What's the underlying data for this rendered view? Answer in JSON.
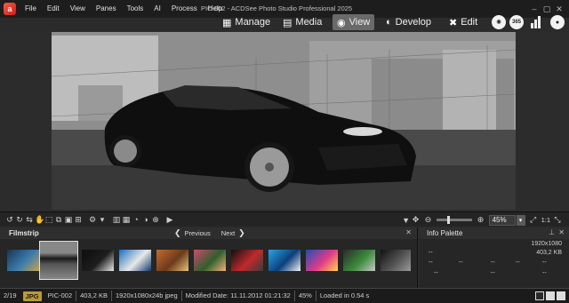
{
  "app": {
    "logo_letter": "a",
    "window_title": "PIC-002 - ACDSee Photo Studio Professional 2025"
  },
  "menu": [
    {
      "id": "file",
      "label": "File"
    },
    {
      "id": "edit",
      "label": "Edit"
    },
    {
      "id": "view",
      "label": "View"
    },
    {
      "id": "panes",
      "label": "Panes"
    },
    {
      "id": "tools",
      "label": "Tools"
    },
    {
      "id": "ai",
      "label": "AI"
    },
    {
      "id": "process",
      "label": "Process"
    },
    {
      "id": "help",
      "label": "Help"
    }
  ],
  "modes": {
    "manage": "Manage",
    "media": "Media",
    "view": "View",
    "develop": "Develop",
    "edit": "Edit",
    "active": "View",
    "badge_365": "365"
  },
  "viewer_toolbar": {
    "zoom_value": "45%",
    "zoom_slider_fraction": 0.3,
    "ratio_label": "1:1"
  },
  "filmstrip": {
    "title": "Filmstrip",
    "previous": "Previous",
    "next": "Next",
    "thumbnails": [
      {
        "name": "thumb-1",
        "palette": [
          "#1a3550",
          "#3b7cae",
          "#c9a34b"
        ]
      },
      {
        "name": "thumb-2-selected",
        "palette": [
          "#888",
          "#1a1a1a",
          "#555"
        ]
      },
      {
        "name": "thumb-3",
        "palette": [
          "#0d0d0d",
          "#1d1d1d",
          "#e8e8e8"
        ]
      },
      {
        "name": "thumb-4",
        "palette": [
          "#1a6fbf",
          "#e8e8e8",
          "#0f3b70"
        ]
      },
      {
        "name": "thumb-5",
        "palette": [
          "#c56a2e",
          "#6b3b1c",
          "#e9c27a"
        ]
      },
      {
        "name": "thumb-6",
        "palette": [
          "#d04a6b",
          "#2f5f2c",
          "#f3b07a"
        ]
      },
      {
        "name": "thumb-7",
        "palette": [
          "#0f0f0f",
          "#c02a2a",
          "#3a3a3a"
        ]
      },
      {
        "name": "thumb-8",
        "palette": [
          "#2aa3e6",
          "#0d3f7a",
          "#f2f2f2"
        ]
      },
      {
        "name": "thumb-9",
        "palette": [
          "#1a4fb3",
          "#e23a8a",
          "#ffd34a"
        ]
      },
      {
        "name": "thumb-10",
        "palette": [
          "#2a2a2a",
          "#3b8b3b",
          "#c8c8c8"
        ]
      },
      {
        "name": "thumb-11",
        "palette": [
          "#111",
          "#555",
          "#999"
        ]
      }
    ]
  },
  "info_palette": {
    "title": "Info Palette",
    "dimensions": "1920x1080",
    "file_size": "403,2 KB",
    "placeholder": "--"
  },
  "statusbar": {
    "position": "2/19",
    "format": "JPG",
    "filename": "PIC-002",
    "size": "403,2 KB",
    "image_info": "1920x1080x24b jpeg",
    "modified": "Modified Date: 11.11.2012 01:21:32",
    "zoom": "45%",
    "loaded": "Loaded in 0.54 s"
  }
}
